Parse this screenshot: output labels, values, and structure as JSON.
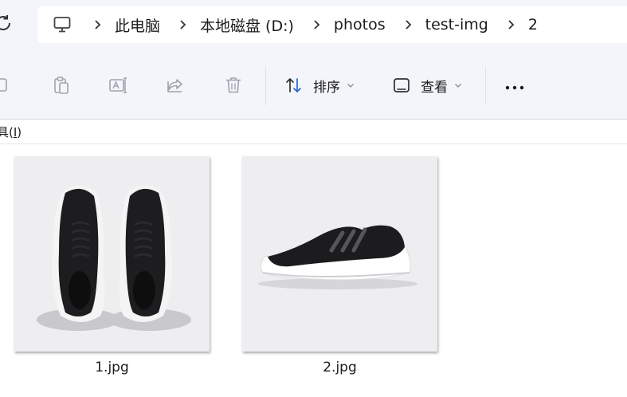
{
  "breadcrumb": {
    "pc_icon": "computer-icon",
    "segments": [
      "此电脑",
      "本地磁盘 (D:)",
      "photos",
      "test-img",
      "2"
    ]
  },
  "toolbar": {
    "icons": [
      "copy-icon",
      "paste-icon",
      "rename-icon",
      "share-icon",
      "delete-icon"
    ],
    "sort_label": "排序",
    "view_label": "查看",
    "more_icon": "more-icon"
  },
  "menubar": {
    "tools_label_prefix": "具(",
    "tools_accel": "I",
    "tools_label_suffix": ")"
  },
  "files": [
    {
      "name": "1.jpg",
      "thumb": "sneakers-top-view-image"
    },
    {
      "name": "2.jpg",
      "thumb": "sneaker-side-view-image"
    }
  ],
  "colors": {
    "chrome_bg": "#f3f5fb",
    "disabled_icon": "#9ea4ad",
    "thumb_bg": "#eeedf0"
  }
}
